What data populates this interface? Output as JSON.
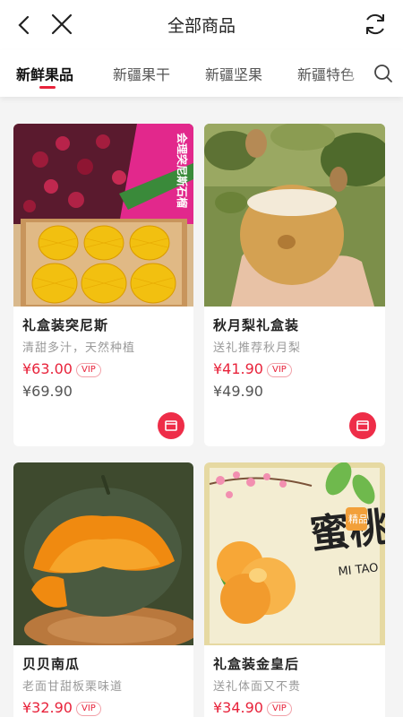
{
  "header": {
    "title": "全部商品"
  },
  "tabs": [
    {
      "label": "新鲜果品",
      "active": true
    },
    {
      "label": "新疆果干",
      "active": false
    },
    {
      "label": "新疆坚果",
      "active": false
    },
    {
      "label": "新疆特色",
      "active": false
    }
  ],
  "products": [
    {
      "name": "礼盒装突尼斯",
      "desc": "清甜多汁，天然种植",
      "price": "¥63.00",
      "vip": "VIP",
      "original_price": "¥69.90",
      "box_text": "会理突尼斯石榴"
    },
    {
      "name": "秋月梨礼盒装",
      "desc": "送礼推荐秋月梨",
      "price": "¥41.90",
      "vip": "VIP",
      "original_price": "¥49.90"
    },
    {
      "name": "贝贝南瓜",
      "desc": "老面甘甜板栗味道",
      "price": "¥32.90",
      "vip": "VIP",
      "original_price": ""
    },
    {
      "name": "礼盒装金皇后",
      "desc": "送礼体面又不贵",
      "price": "¥34.90",
      "vip": "VIP",
      "original_price": "",
      "box_text": {
        "big": "蜜桃",
        "seal": "精品",
        "latin": "MI TAO"
      }
    }
  ],
  "colors": {
    "accent": "#e8233b",
    "cart": "#ee2d48"
  }
}
